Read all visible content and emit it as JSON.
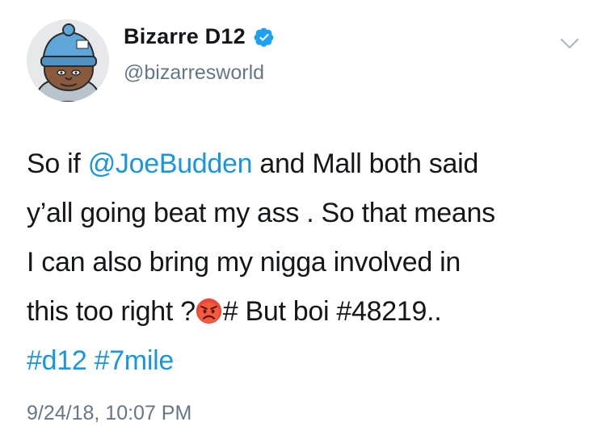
{
  "author": {
    "display_name": "Bizarre D12",
    "handle": "@bizarresworld",
    "verified": true
  },
  "tweet": {
    "lines": [
      {
        "parts": [
          {
            "t": "So if ",
            "link": false
          },
          {
            "t": "@JoeBudden",
            "link": true
          },
          {
            "t": " and Mall both said",
            "link": false
          }
        ]
      },
      {
        "parts": [
          {
            "t": "y’all going beat my ass . So that means",
            "link": false
          }
        ]
      },
      {
        "parts": [
          {
            "t": "I can also bring my nigga involved in",
            "link": false
          }
        ]
      },
      {
        "parts": [
          {
            "t": "this too right ?",
            "link": false
          },
          {
            "emoji": "angry-face"
          },
          {
            "t": "# But boi #48219..",
            "link": false
          }
        ]
      },
      {
        "parts": [
          {
            "t": "#d12",
            "link": true
          },
          {
            "t": " ",
            "link": false
          },
          {
            "t": "#7mile",
            "link": true
          }
        ]
      }
    ]
  },
  "timestamp": "9/24/18, 10:07 PM",
  "colors": {
    "link": "#1b95e0",
    "text": "#14171a",
    "secondary": "#657786",
    "verified": "#1da1f2"
  },
  "icons": [
    "verified-badge-icon",
    "chevron-down-icon",
    "angry-face-emoji-icon"
  ]
}
